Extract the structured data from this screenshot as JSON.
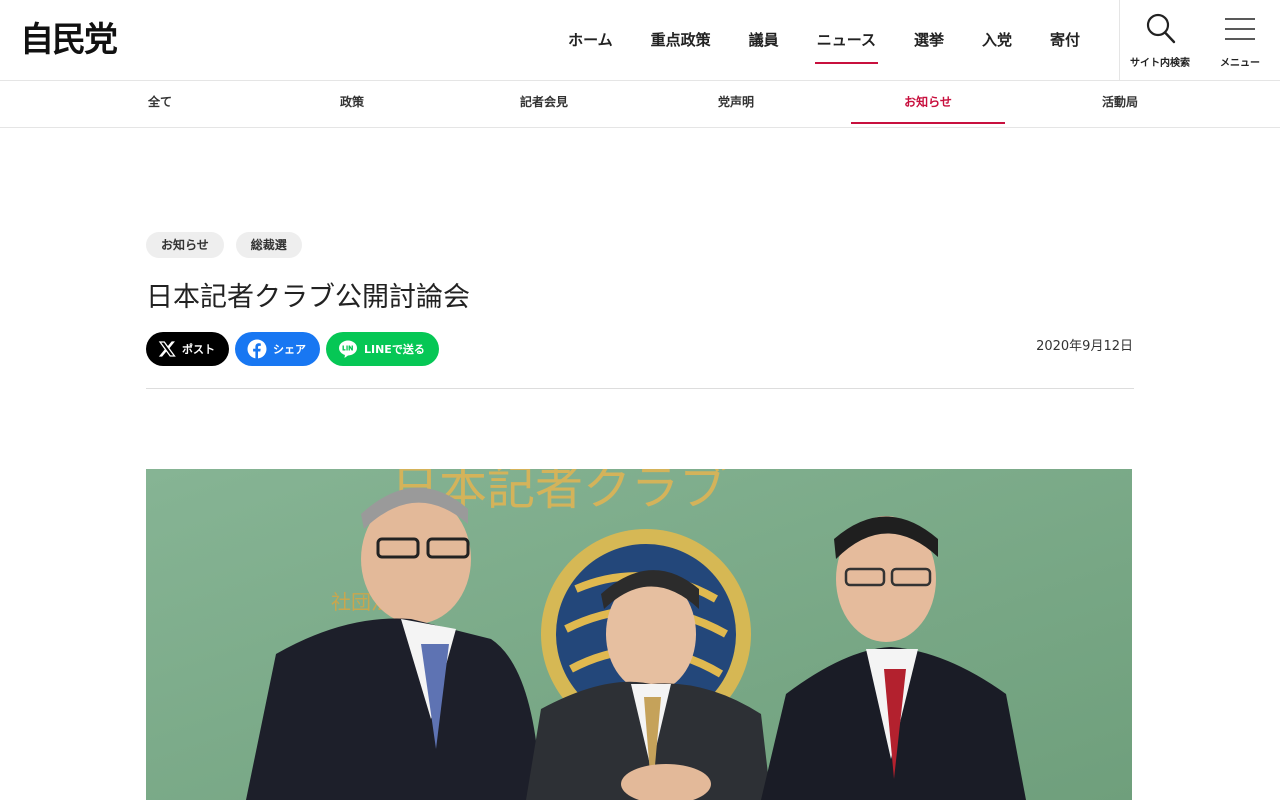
{
  "header": {
    "logo": "自民党",
    "nav": [
      {
        "label": "ホーム"
      },
      {
        "label": "重点政策"
      },
      {
        "label": "議員"
      },
      {
        "label": "ニュース"
      },
      {
        "label": "選挙"
      },
      {
        "label": "入党"
      },
      {
        "label": "寄付"
      }
    ],
    "active_nav": "ニュース",
    "search_label": "サイト内検索",
    "menu_label": "メニュー"
  },
  "subnav": {
    "items": [
      {
        "label": "全て"
      },
      {
        "label": "政策"
      },
      {
        "label": "記者会見"
      },
      {
        "label": "党声明"
      },
      {
        "label": "お知らせ"
      },
      {
        "label": "活動局"
      }
    ],
    "active": "お知らせ"
  },
  "article": {
    "tags": [
      "お知らせ",
      "総裁選"
    ],
    "title": "日本記者クラブ公開討論会",
    "date": "2020年9月12日",
    "share": {
      "x": "ポスト",
      "facebook": "シェア",
      "line": "LINEで送る"
    },
    "photo_emblem_text": "日本記者クラブ",
    "photo_side_text": "社団法人"
  },
  "colors": {
    "accent": "#c8103e",
    "x": "#000000",
    "facebook": "#1877f2",
    "line": "#06c755",
    "photo_bg": "#7fae8a"
  }
}
